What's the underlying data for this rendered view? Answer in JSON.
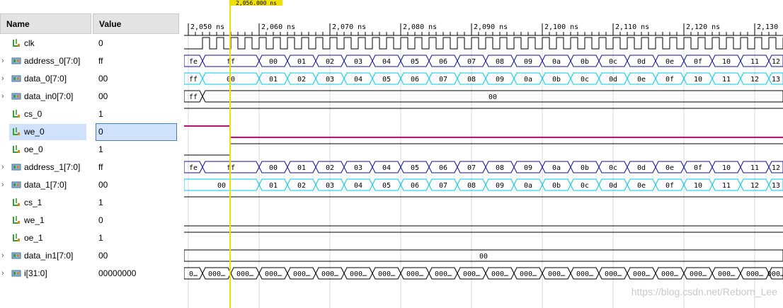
{
  "headers": {
    "name": "Name",
    "value": "Value"
  },
  "signals": [
    {
      "name": "clk",
      "value": "0",
      "kind": "bit",
      "expandable": false
    },
    {
      "name": "address_0[7:0]",
      "value": "ff",
      "kind": "bus",
      "expandable": true
    },
    {
      "name": "data_0[7:0]",
      "value": "00",
      "kind": "bus",
      "expandable": true
    },
    {
      "name": "data_in0[7:0]",
      "value": "00",
      "kind": "bus",
      "expandable": true
    },
    {
      "name": "cs_0",
      "value": "1",
      "kind": "bit",
      "expandable": false
    },
    {
      "name": "we_0",
      "value": "0",
      "kind": "bit",
      "expandable": false,
      "selected": true
    },
    {
      "name": "oe_0",
      "value": "1",
      "kind": "bit",
      "expandable": false
    },
    {
      "name": "address_1[7:0]",
      "value": "ff",
      "kind": "bus",
      "expandable": true
    },
    {
      "name": "data_1[7:0]",
      "value": "00",
      "kind": "bus",
      "expandable": true
    },
    {
      "name": "cs_1",
      "value": "1",
      "kind": "bit",
      "expandable": false
    },
    {
      "name": "we_1",
      "value": "0",
      "kind": "bit",
      "expandable": false
    },
    {
      "name": "oe_1",
      "value": "1",
      "kind": "bit",
      "expandable": false
    },
    {
      "name": "data_in1[7:0]",
      "value": "00",
      "kind": "bus",
      "expandable": true
    },
    {
      "name": "i[31:0]",
      "value": "00000000",
      "kind": "bus",
      "expandable": true
    }
  ],
  "time_ticks": [
    "2,050 ns",
    "2,060 ns",
    "2,070 ns",
    "2,080 ns",
    "2,090 ns",
    "2,100 ns",
    "2,110 ns",
    "2,120 ns",
    "2,130 ns"
  ],
  "cursor_label": "2,056.000 ns",
  "wave_labels": {
    "address": [
      "fe",
      "ff",
      "00",
      "01",
      "02",
      "03",
      "04",
      "05",
      "06",
      "07",
      "08",
      "09",
      "0a",
      "0b",
      "0c",
      "0d",
      "0e",
      "0f",
      "10",
      "11",
      "12"
    ],
    "data": [
      "ff",
      "00",
      "01",
      "02",
      "03",
      "04",
      "05",
      "06",
      "07",
      "08",
      "09",
      "0a",
      "0b",
      "0c",
      "0d",
      "0e",
      "0f",
      "10",
      "11",
      "12",
      "13"
    ],
    "data_in0": [
      "ff",
      "00"
    ],
    "data_1": [
      "00",
      "01",
      "02",
      "03",
      "04",
      "05",
      "06",
      "07",
      "08",
      "09",
      "0a",
      "0b",
      "0c",
      "0d",
      "0e",
      "0f",
      "10",
      "11",
      "12",
      "13"
    ],
    "data_in1": [
      "00"
    ],
    "i_first": "0…",
    "i_seg": "000…"
  },
  "watermark": "https://blog.csdn.net/Reborn_Lee",
  "colors": {
    "bus": "#1010a0",
    "data": "#00c8e8",
    "we": "#e0007a",
    "cursor": "#f0e000",
    "grid": "#d8d8d8",
    "highlight": "#cfe1fb"
  }
}
